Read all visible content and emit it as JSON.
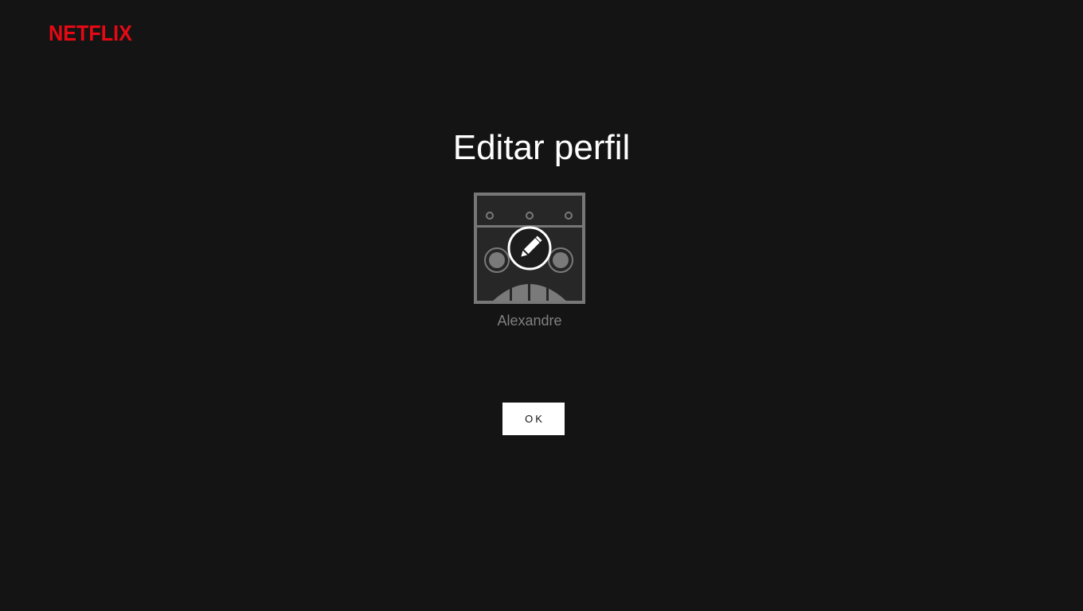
{
  "brand": {
    "name": "NETFLIX",
    "color": "#e50914"
  },
  "page": {
    "title": "Editar perfil",
    "background_color": "#141414"
  },
  "profile": {
    "name": "Alexandre",
    "avatar_icon": "robot-avatar-icon",
    "edit_icon": "pencil-edit-icon"
  },
  "actions": {
    "ok_label": "OK"
  }
}
